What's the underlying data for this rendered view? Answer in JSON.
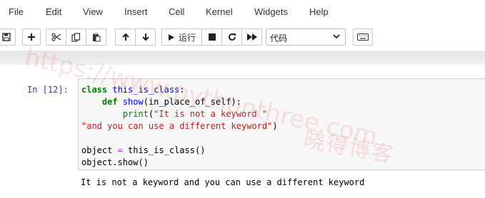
{
  "menu": {
    "items": [
      "File",
      "Edit",
      "View",
      "Insert",
      "Cell",
      "Kernel",
      "Widgets",
      "Help"
    ]
  },
  "toolbar": {
    "run_label": "运行",
    "cell_type": "代码"
  },
  "cell": {
    "prompt": "In  [12]:",
    "code": {
      "l1_kw": "class",
      "l1_name": "this_is_class",
      "l1_end": ":",
      "l2_indent": "    ",
      "l2_kw": "def",
      "l2_name": "show",
      "l2_end": "(in_place_of_self):",
      "l3_indent": "        ",
      "l3_func": "print",
      "l3_open": "(",
      "l3_str": "\"It is not a keyword \"",
      "l4_str": "\"and you can use a different keyword\"",
      "l4_end": ")",
      "l6_var": "object",
      "l6_eq": " = ",
      "l6_call": "this_is_class()",
      "l7": "object.show()"
    },
    "output": "It is not a keyword and you can use a different keyword"
  },
  "watermark": {
    "url": "https://www.pythonthree.com",
    "cn": "晓得博客"
  }
}
